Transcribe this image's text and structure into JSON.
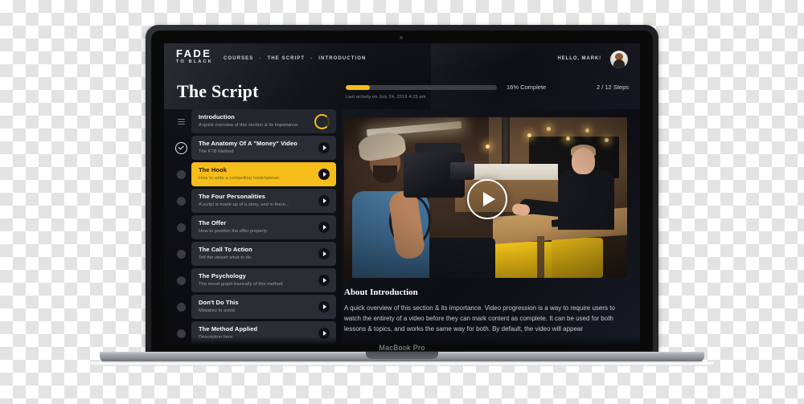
{
  "device": {
    "label": "MacBook Pro"
  },
  "colors": {
    "accent": "#f7bd1b",
    "app_bg": "#0e0f13",
    "card_bg": "#2b2d34",
    "text": "#ffffff",
    "muted": "#9a9ca3"
  },
  "topnav": {
    "logo_main": "FADE",
    "logo_sub": "TO BLACK",
    "breadcrumbs": [
      "COURSES",
      "THE SCRIPT",
      "INTRODUCTION"
    ],
    "separator": "›",
    "greeting": "HELLO, MARK!",
    "avatar_name": "user-avatar"
  },
  "header": {
    "page_title": "The Script",
    "progress_percent": 16,
    "progress_label": "16% Complete",
    "steps_label": "2  /  12 Steps",
    "last_activity": "Last activity on July 24, 2019 4:25 am"
  },
  "sidebar": {
    "lessons": [
      {
        "title": "Introduction",
        "subtitle": "A quick overview of this section & its importance.",
        "state": "current",
        "marker": "handle",
        "action": "ring"
      },
      {
        "title": "The Anatomy Of A \"Money\" Video",
        "subtitle": "The FTB Method",
        "state": "complete",
        "marker": "check",
        "action": "play"
      },
      {
        "title": "The Hook",
        "subtitle": "How to write a compelling hook/opener.",
        "state": "active",
        "marker": "dot",
        "action": "play"
      },
      {
        "title": "The Four Personalities",
        "subtitle": "A script is made up of a story, and in there...",
        "state": "locked",
        "marker": "dot",
        "action": "play"
      },
      {
        "title": "The Offer",
        "subtitle": "How to position the offer properly.",
        "state": "locked",
        "marker": "dot",
        "action": "play"
      },
      {
        "title": "The Call To Action",
        "subtitle": "Tell the viewer what to do.",
        "state": "locked",
        "marker": "dot",
        "action": "play"
      },
      {
        "title": "The Psychology",
        "subtitle": "The mood graph basically of this method.",
        "state": "locked",
        "marker": "dot",
        "action": "play"
      },
      {
        "title": "Don't Do This",
        "subtitle": "Mistakes to avoid.",
        "state": "locked",
        "marker": "dot",
        "action": "play"
      },
      {
        "title": "The Method Applied",
        "subtitle": "Description here",
        "state": "locked",
        "marker": "dot",
        "action": "play"
      }
    ]
  },
  "content": {
    "video": {
      "play_label": "play-button"
    },
    "about_title": "About Introduction",
    "about_body": "A quick overview of this section & its importance. Video progression is a way to require users to watch the entirety of a video before they can mark content as complete. It can be used for both lessons & topics, and works the same way for both. By default, the video will appear"
  }
}
